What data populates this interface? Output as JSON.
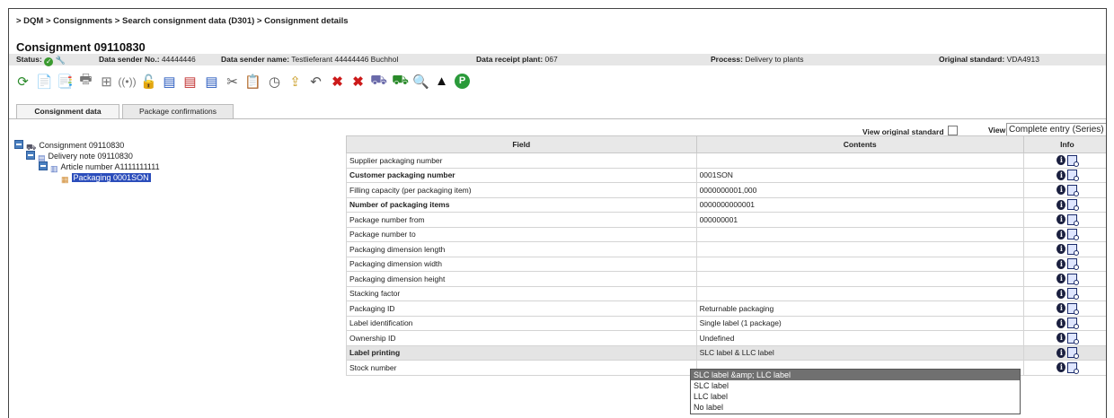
{
  "breadcrumb": "> DQM > Consignments > Search consignment data (D301) > Consignment details",
  "title": "Consignment 09110830",
  "info": {
    "status_label": "Status:",
    "data_sender_no_label": "Data sender No.:",
    "data_sender_no": "44444446",
    "data_sender_name_label": "Data sender name:",
    "data_sender_name": "Testlieferant 44444446 Buchhol",
    "receipt_plant_label": "Data receipt plant:",
    "receipt_plant": "067",
    "process_label": "Process:",
    "process": "Delivery to plants",
    "original_standard_label": "Original standard:",
    "original_standard": "VDA4913"
  },
  "toolbar_icons": [
    "refresh-icon",
    "document-icon",
    "document-copy-icon",
    "printer-icon",
    "network-icon",
    "signal-icon",
    "unlock-icon",
    "report-icon",
    "report-red-icon",
    "report-check-icon",
    "cut-icon",
    "paste-icon",
    "clock-icon",
    "export-icon",
    "undo-icon",
    "delete-icon",
    "delete-all-icon",
    "transport-icon",
    "truck-icon",
    "preview-icon",
    "upload-icon",
    "p-icon"
  ],
  "tabs": [
    {
      "label": "Consignment data",
      "active": true
    },
    {
      "label": "Package confirmations",
      "active": false
    }
  ],
  "view_original_label": "View original standard",
  "view_label": "View:",
  "view_value": "Complete entry (Series)",
  "tree": [
    {
      "label": "Consignment 09110830",
      "level": 0
    },
    {
      "label": "Delivery note 09110830",
      "level": 1
    },
    {
      "label": "Article number A1111111111",
      "level": 2
    },
    {
      "label": "Packaging 0001SON",
      "level": 3,
      "selected": true
    }
  ],
  "table": {
    "headers": [
      "Field",
      "Contents",
      "Info"
    ],
    "rows": [
      {
        "field": "Supplier packaging number",
        "contents": "",
        "bold": false
      },
      {
        "field": "Customer packaging number",
        "contents": "0001SON",
        "bold": true
      },
      {
        "field": "Filling capacity (per packaging item)",
        "contents": "0000000001,000",
        "bold": false
      },
      {
        "field": "Number of packaging items",
        "contents": "0000000000001",
        "bold": true
      },
      {
        "field": "Package number from",
        "contents": "000000001",
        "bold": false
      },
      {
        "field": "Package number to",
        "contents": "",
        "bold": false
      },
      {
        "field": "Packaging dimension length",
        "contents": "",
        "bold": false
      },
      {
        "field": "Packaging dimension width",
        "contents": "",
        "bold": false
      },
      {
        "field": "Packaging dimension height",
        "contents": "",
        "bold": false
      },
      {
        "field": "Stacking factor",
        "contents": "",
        "bold": false
      },
      {
        "field": "Packaging ID",
        "contents": "Returnable packaging",
        "bold": false
      },
      {
        "field": "Label identification",
        "contents": "Single label (1 package)",
        "bold": false
      },
      {
        "field": "Ownership ID",
        "contents": "Undefined",
        "bold": false
      },
      {
        "field": "Label printing",
        "contents": "SLC label & LLC label",
        "bold": true,
        "highlight": true
      },
      {
        "field": "Stock number",
        "contents": "",
        "bold": false
      }
    ]
  },
  "dropdown_options": [
    "SLC label &amp; LLC label",
    "SLC label",
    "LLC label",
    "No label"
  ]
}
